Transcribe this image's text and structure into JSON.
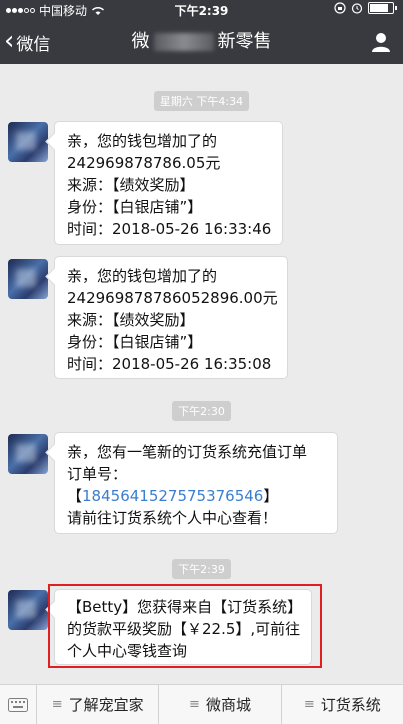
{
  "status_bar": {
    "carrier": "中国移动",
    "time": "下午2:39"
  },
  "nav": {
    "back_label": "微信",
    "title_prefix": "微",
    "title_suffix": "新零售"
  },
  "chat": {
    "timestamps": [
      "星期六 下午4:34",
      "下午2:30",
      "下午2:39"
    ],
    "messages": [
      {
        "lines": [
          "亲，您的钱包增加了的",
          "242969878786.05元",
          "来源：【绩效奖励】",
          "身份：【白银店铺”】",
          "时间：2018-05-26 16:33:46"
        ]
      },
      {
        "lines": [
          "亲，您的钱包增加了的",
          "242969878786052896.00元",
          "来源：【绩效奖励】",
          "身份：【白银店铺”】",
          "时间：2018-05-26 16:35:08"
        ]
      },
      {
        "line1": "亲，您有一笔新的订货系统充值订单",
        "line2": "订单号：",
        "order_open": "【",
        "order_no": "1845641527575376546",
        "order_close": "】",
        "line4": "请前往订货系统个人中心查看！"
      },
      {
        "lines": [
          "【Betty】您获得来自【订货系统】",
          "的货款平级奖励【￥22.5】,可前往",
          "个人中心零钱查询"
        ]
      }
    ]
  },
  "bottom_menu": {
    "items": [
      "了解宠宜家",
      "微商城",
      "订货系统"
    ]
  },
  "icons": {
    "back": "chevron-left-icon",
    "profile": "person-icon",
    "keyboard": "keyboard-icon",
    "menu": "menu-lines-icon"
  },
  "colors": {
    "nav_bg": "#393a3f",
    "chat_bg": "#ebebeb",
    "link": "#3a7ed1",
    "highlight": "#e02020"
  }
}
